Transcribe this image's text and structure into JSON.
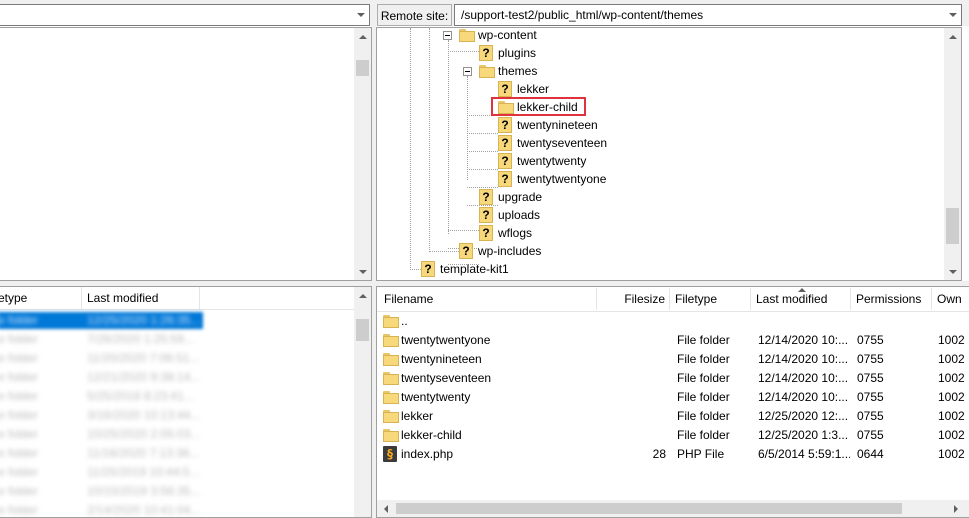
{
  "remote": {
    "label": "Remote site:",
    "path": "/support-test2/public_html/wp-content/themes"
  },
  "tree": [
    {
      "label": "wp-content",
      "icon": "folder-open-icon"
    },
    {
      "label": "plugins",
      "icon": "unknown-folder-icon"
    },
    {
      "label": "themes",
      "icon": "folder-open-icon"
    },
    {
      "label": "lekker",
      "icon": "unknown-folder-icon"
    },
    {
      "label": "lekker-child",
      "icon": "folder-icon",
      "highlighted": true
    },
    {
      "label": "twentynineteen",
      "icon": "unknown-folder-icon"
    },
    {
      "label": "twentyseventeen",
      "icon": "unknown-folder-icon"
    },
    {
      "label": "twentytwenty",
      "icon": "unknown-folder-icon"
    },
    {
      "label": "twentytwentyone",
      "icon": "unknown-folder-icon"
    },
    {
      "label": "upgrade",
      "icon": "unknown-folder-icon"
    },
    {
      "label": "uploads",
      "icon": "unknown-folder-icon"
    },
    {
      "label": "wflogs",
      "icon": "unknown-folder-icon"
    },
    {
      "label": "wp-includes",
      "icon": "unknown-folder-icon"
    },
    {
      "label": "template-kit1",
      "icon": "unknown-folder-icon"
    }
  ],
  "local_list": {
    "columns": [
      "etype",
      "Last modified"
    ],
    "rows": [
      [
        "e folder",
        "12/25/2020 1:26:35..."
      ],
      [
        "e folder",
        "7/26/2020 1:25:59..."
      ],
      [
        "e folder",
        "11/20/2020 7:06:51..."
      ],
      [
        "e folder",
        "12/21/2020 9:38:14..."
      ],
      [
        "e folder",
        "5/25/2018 8:23:41..."
      ],
      [
        "e folder",
        "3/16/2020 10:13:44..."
      ],
      [
        "e folder",
        "10/25/2020 2:05:03..."
      ],
      [
        "e folder",
        "11/16/2020 7:13:36..."
      ],
      [
        "e folder",
        "11/25/2019 10:44:5..."
      ],
      [
        "e folder",
        "10/10/2019 3:56:35..."
      ],
      [
        "e folder",
        "2/14/2020 10:41:04..."
      ]
    ]
  },
  "remote_list": {
    "columns": [
      "Filename",
      "Filesize",
      "Filetype",
      "Last modified",
      "Permissions",
      "Own"
    ],
    "rows": [
      {
        "icon": "folder-icon",
        "name": "..",
        "size": "",
        "type": "",
        "modified": "",
        "perms": "",
        "owner": ""
      },
      {
        "icon": "folder-icon",
        "name": "twentytwentyone",
        "size": "",
        "type": "File folder",
        "modified": "12/14/2020 10:...",
        "perms": "0755",
        "owner": "1002"
      },
      {
        "icon": "folder-icon",
        "name": "twentynineteen",
        "size": "",
        "type": "File folder",
        "modified": "12/14/2020 10:...",
        "perms": "0755",
        "owner": "1002"
      },
      {
        "icon": "folder-icon",
        "name": "twentyseventeen",
        "size": "",
        "type": "File folder",
        "modified": "12/14/2020 10:...",
        "perms": "0755",
        "owner": "1002"
      },
      {
        "icon": "folder-icon",
        "name": "twentytwenty",
        "size": "",
        "type": "File folder",
        "modified": "12/14/2020 10:...",
        "perms": "0755",
        "owner": "1002"
      },
      {
        "icon": "folder-icon",
        "name": "lekker",
        "size": "",
        "type": "File folder",
        "modified": "12/25/2020 12:...",
        "perms": "0755",
        "owner": "1002"
      },
      {
        "icon": "folder-icon",
        "name": "lekker-child",
        "size": "",
        "type": "File folder",
        "modified": "12/25/2020 1:3...",
        "perms": "0755",
        "owner": "1002"
      },
      {
        "icon": "php-file-icon",
        "name": "index.php",
        "size": "28",
        "type": "PHP File",
        "modified": "6/5/2014 5:59:1...",
        "perms": "0644",
        "owner": "1002"
      }
    ]
  },
  "colors": {
    "selection": "#0078d7",
    "highlight_box": "#e0323c",
    "folder": "#f7d97b"
  }
}
